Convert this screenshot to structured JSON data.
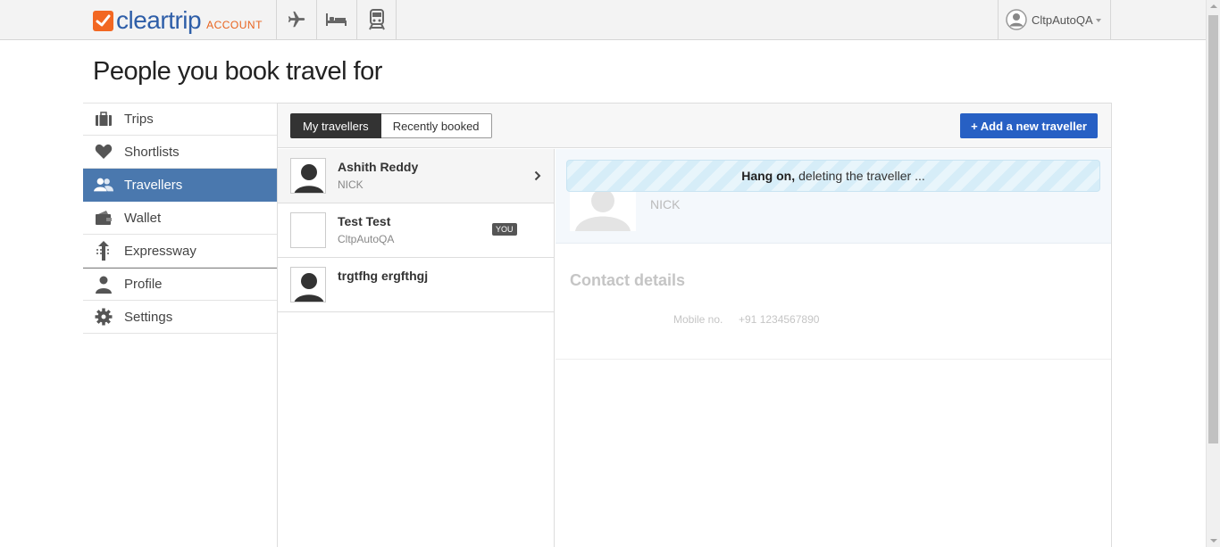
{
  "header": {
    "logo_text": "cleartrip",
    "logo_sub": "ACCOUNT",
    "nav_icons": [
      "flight-icon",
      "hotel-icon",
      "train-icon"
    ],
    "user_name": "CltpAutoQA"
  },
  "page": {
    "title": "People you book travel for"
  },
  "sidebar": {
    "items": [
      {
        "label": "Trips",
        "icon": "briefcase-icon"
      },
      {
        "label": "Shortlists",
        "icon": "heart-icon"
      },
      {
        "label": "Travellers",
        "icon": "people-icon",
        "active": true
      },
      {
        "label": "Wallet",
        "icon": "wallet-icon"
      },
      {
        "label": "Expressway",
        "icon": "expressway-icon"
      },
      {
        "label": "Profile",
        "icon": "person-icon"
      },
      {
        "label": "Settings",
        "icon": "gear-icon"
      }
    ]
  },
  "tabs": {
    "my_travellers": "My travellers",
    "recently_booked": "Recently booked"
  },
  "add_button": "+ Add a new traveller",
  "travellers": [
    {
      "name": "Ashith Reddy",
      "sub": "NICK"
    },
    {
      "name": "Test Test",
      "sub": "CltpAutoQA",
      "badge": "YOU"
    },
    {
      "name": "trgtfhg ergfthgj",
      "sub": ""
    }
  ],
  "detail": {
    "nickname": "NICK",
    "notice_bold": "Hang on,",
    "notice_text": "deleting the traveller ...",
    "contact_title": "Contact details",
    "mobile_label": "Mobile no.",
    "mobile_value": "+91 1234567890"
  },
  "colors": {
    "brand_blue": "#2e5ea8",
    "brand_orange": "#f26722",
    "active_nav": "#4a78ae",
    "add_button": "#2760c4"
  }
}
